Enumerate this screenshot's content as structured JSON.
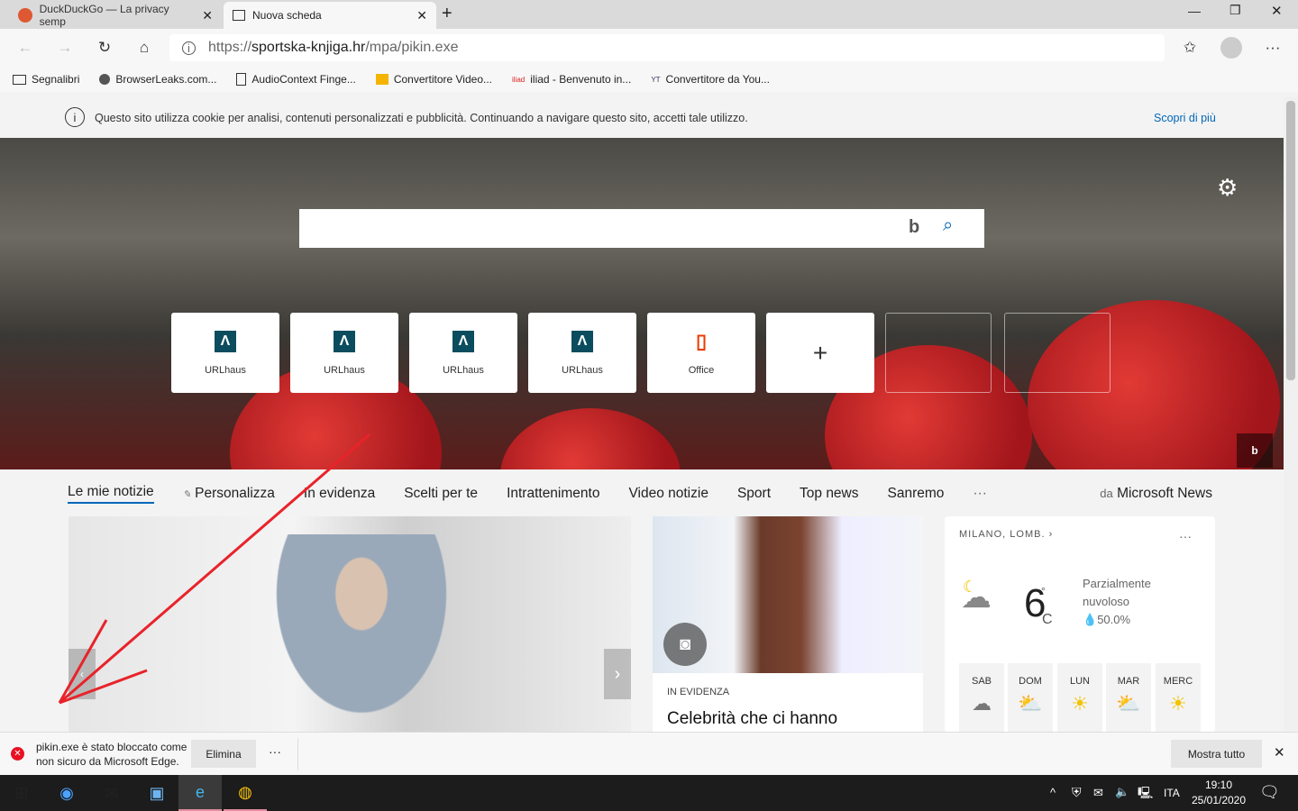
{
  "tabs": [
    {
      "label": "DuckDuckGo — La privacy semp",
      "active": false
    },
    {
      "label": "Nuova scheda",
      "active": true
    }
  ],
  "address": {
    "url_prefix": "https://",
    "url_host": "sportska-knjiga.hr",
    "url_path": "/mpa/pikin.exe"
  },
  "bookmarks": [
    "Segnalibri",
    "BrowserLeaks.com...",
    "AudioContext Finge...",
    "Convertitore Video...",
    "iliad - Benvenuto in...",
    "Convertitore da You..."
  ],
  "cookie": {
    "text": "Questo sito utilizza cookie per analisi, contenuti personalizzati e pubblicità. Continuando a navigare questo sito, accetti tale utilizzo.",
    "link": "Scopri di più"
  },
  "tiles": [
    {
      "label": "URLhaus",
      "icon": "urlhaus-icon"
    },
    {
      "label": "URLhaus",
      "icon": "urlhaus-icon"
    },
    {
      "label": "URLhaus",
      "icon": "urlhaus-icon"
    },
    {
      "label": "URLhaus",
      "icon": "urlhaus-icon"
    },
    {
      "label": "Office",
      "icon": "office-icon"
    }
  ],
  "news_nav": {
    "items": [
      "Le mie notizie",
      "Personalizza",
      "In evidenza",
      "Scelti per te",
      "Intrattenimento",
      "Video notizie",
      "Sport",
      "Top news",
      "Sanremo"
    ],
    "more": "···",
    "source_prefix": "da",
    "source": "Microsoft News"
  },
  "card2": {
    "tag": "IN EVIDENZA",
    "title": "Celebrità che ci hanno"
  },
  "weather": {
    "location": "MILANO, LOMB.",
    "temp": "6",
    "unit_deg": "°",
    "unit": "C",
    "condition1": "Parzialmente",
    "condition2": "nuvoloso",
    "precip": "50.0%",
    "days": [
      {
        "d": "SAB",
        "icon": "cloudy"
      },
      {
        "d": "DOM",
        "icon": "partly-sunny"
      },
      {
        "d": "LUN",
        "icon": "sunny"
      },
      {
        "d": "MAR",
        "icon": "partly-sunny"
      },
      {
        "d": "MERC",
        "icon": "sunny"
      }
    ]
  },
  "download": {
    "line1": "pikin.exe è stato bloccato come",
    "line2": "non sicuro da Microsoft Edge.",
    "delete": "Elimina",
    "more": "···",
    "show_all": "Mostra tutto"
  },
  "taskbar": {
    "lang": "ITA",
    "time": "19:10",
    "date": "25/01/2020"
  },
  "colors": {
    "accent": "#0067b8",
    "arrow": "#e8232a",
    "blocked": "#e81123"
  }
}
